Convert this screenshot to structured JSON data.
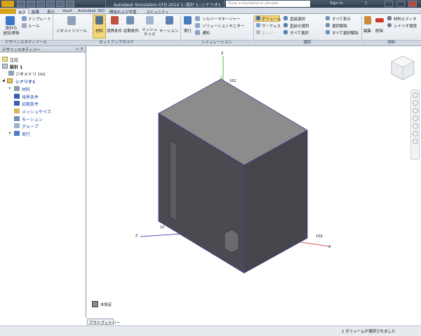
{
  "titlebar": {
    "app_title": "Autodesk Simulation CFD 2014   1::設計 1::シナリオ1",
    "search_placeholder": "Type a keyword or phrase",
    "sign_in": "Sign In",
    "help": "?"
  },
  "tabs": [
    "設定",
    "結果",
    "表示",
    "Vault",
    "Autodesk 360",
    "開始および学習",
    "コミュニティ"
  ],
  "active_tab": "設定",
  "ribbon": {
    "design_study_left": "設計の\n追加/更新",
    "template": "テンプレート",
    "rule": "ルール",
    "geometry_tools": "ジオメトリツール",
    "material": "材料",
    "boundary_conditions": "境界条件",
    "initial_conditions": "初期条件",
    "mesh_size": "メッシュ\nサイズ",
    "motion": "モーション",
    "run": "実行",
    "solver_manager": "ソルバーマネージャー",
    "solution_monitor": "ソリューションモニター",
    "notify": "通知",
    "volume": "ボリューム",
    "surface": "サーフェス",
    "edge": "エッジ",
    "direct_select": "直接選択",
    "select_previous": "直前の選択",
    "select_all": "すべて選択",
    "show_all": "すべて表示",
    "deselect": "選択解除",
    "deselect_all": "すべて選択解除",
    "edit": "編集",
    "delete": "削除",
    "material_editor": "材料エディタ",
    "scenario_env": "シナリオ環境",
    "panel_design_study": "デザインスタディツール",
    "panel_setup_tasks": "セットアップタスク",
    "panel_simulation": "シミュレーション",
    "panel_selection": "選択",
    "panel_material": "材料"
  },
  "browser": {
    "title": "デザインスタディバー",
    "items": [
      {
        "label": "注記"
      },
      {
        "label": "設計 1"
      },
      {
        "label": "ジオメトリ (m)"
      },
      {
        "label": "シナリオ1"
      },
      {
        "label": "材料"
      },
      {
        "label": "境界条件"
      },
      {
        "label": "初期条件"
      },
      {
        "label": "メッシュサイズ"
      },
      {
        "label": "モーション"
      },
      {
        "label": "グループ"
      },
      {
        "label": "実行"
      }
    ]
  },
  "viewport": {
    "axis_y": "y",
    "axis_x": "x",
    "axis_z": "z",
    "dim_top": "162",
    "dim_right": "159",
    "dim_left": "12",
    "legend_label": "未設定"
  },
  "output_tab": "アウトプットバー",
  "status": "1 ボリュームが選択されました",
  "colors": {
    "accent": "#f4d77b",
    "model_dark": "#4a4a50",
    "model_top": "#8c8c8c"
  }
}
